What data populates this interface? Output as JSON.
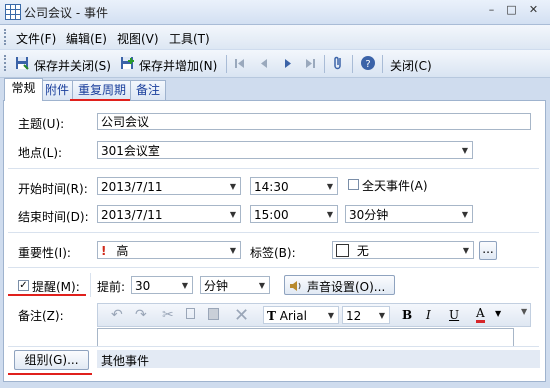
{
  "window": {
    "title": "公司会议 - 事件",
    "minimize": "–",
    "maximize": "□",
    "close": "✕"
  },
  "menu": [
    "文件(F)",
    "编辑(E)",
    "视图(V)",
    "工具(T)"
  ],
  "toolbar": {
    "save_close": "保存并关闭(S)",
    "save_new": "保存并增加(N)",
    "close": "关闭(C)"
  },
  "tabs": [
    "常规",
    "附件",
    "重复周期",
    "备注"
  ],
  "form": {
    "subject_label": "主题(U):",
    "subject_value": "公司会议",
    "location_label": "地点(L):",
    "location_value": "301会议室",
    "start_label": "开始时间(R):",
    "start_date": "2013/7/11",
    "start_time": "14:30",
    "allday_label": "全天事件(A)",
    "end_label": "结束时间(D):",
    "end_date": "2013/7/11",
    "end_time": "15:00",
    "duration": "30分钟",
    "importance_label": "重要性(I):",
    "importance_value": "高",
    "tag_label": "标签(B):",
    "tag_value": "无",
    "tag_button": "...",
    "reminder_label": "提醒(M):",
    "advance_label": "提前:",
    "advance_value": "30",
    "advance_unit": "分钟",
    "sound_button": "声音设置(O)...",
    "notes_label": "备注(Z):",
    "font_name": "Arial",
    "font_size": "12",
    "group_button": "组别(G)...",
    "group_value": "其他事件"
  },
  "colors": {
    "accent": "#e0201c",
    "tab_link": "#1a3f9c"
  }
}
